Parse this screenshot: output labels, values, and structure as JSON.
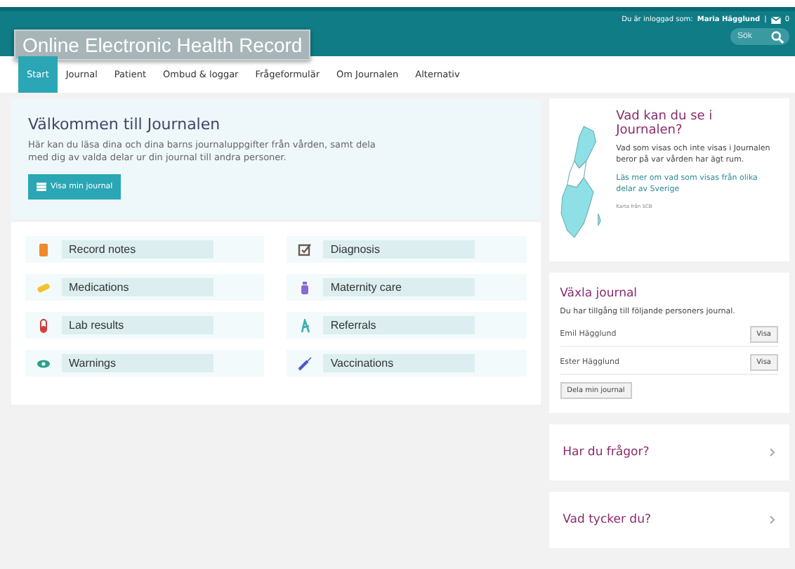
{
  "header": {
    "title": "Online Electronic Health Record",
    "login_label": "Du är inloggad som:",
    "user": "Maria Hägglund",
    "separator": "|",
    "message_count": "0",
    "search": {
      "placeholder": "Sök"
    }
  },
  "nav": [
    {
      "label": "Start",
      "selected": true
    },
    {
      "label": "Journal",
      "selected": false
    },
    {
      "label": "Patient",
      "selected": false
    },
    {
      "label": "Ombud & loggar",
      "selected": false
    },
    {
      "label": "Frågeformulär",
      "selected": false
    },
    {
      "label": "Om Journalen",
      "selected": false
    },
    {
      "label": "Alternativ",
      "selected": false
    }
  ],
  "welcome": {
    "title": "Välkommen till Journalen",
    "text": "Här kan du läsa dina och dina barns journaluppgifter från vården, samt dela med dig av valda delar ur din journal till andra personer.",
    "button": "Visa min journal"
  },
  "categories": [
    {
      "label": "Record notes",
      "kind": "notes"
    },
    {
      "label": "Diagnosis",
      "kind": "diagnosis"
    },
    {
      "label": "Medications",
      "kind": "pill"
    },
    {
      "label": "Maternity care",
      "kind": "maternity"
    },
    {
      "label": "Lab results",
      "kind": "tube"
    },
    {
      "label": "Referrals",
      "kind": "referral"
    },
    {
      "label": "Warnings",
      "kind": "eye"
    },
    {
      "label": "Vaccinations",
      "kind": "syringe"
    }
  ],
  "info_card": {
    "title": "Vad kan du se i Journalen?",
    "text": "Vad som visas och inte visas i Journalen beror på var vården har ägt rum.",
    "link": "Läs mer om vad som visas från olika delar av Sverige",
    "credit": "Karta från SCB"
  },
  "switch_card": {
    "title": "Växla journal",
    "text": "Du har tillgång till följande personers journal.",
    "people": [
      {
        "name": "Emil Hägglund",
        "button": "Visa"
      },
      {
        "name": "Ester Hägglund",
        "button": "Visa"
      }
    ],
    "share_button": "Dela min journal"
  },
  "links": [
    "Har du frågor?",
    "Vad tycker du?"
  ]
}
